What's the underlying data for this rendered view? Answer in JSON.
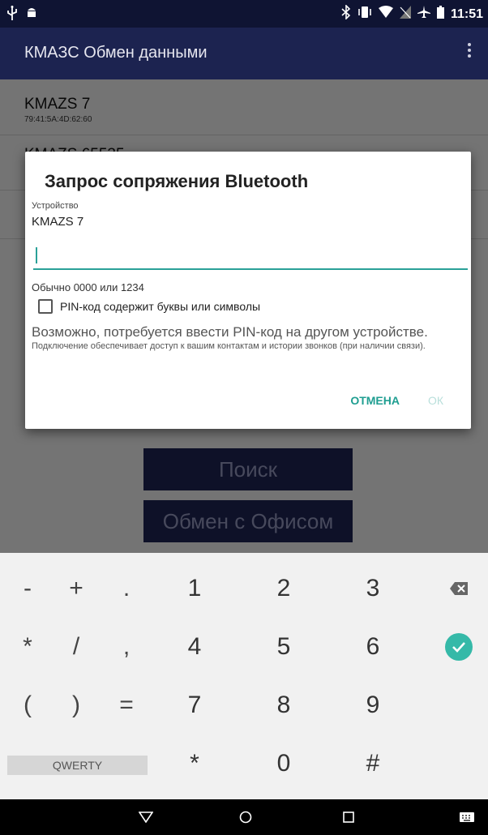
{
  "status_bar": {
    "time": "11:51",
    "left_icons": [
      "usb-icon",
      "android-debug-icon"
    ],
    "right_icons": [
      "bluetooth-icon",
      "vibrate-icon",
      "wifi-icon",
      "signal-off-icon",
      "airplane-icon",
      "battery-icon"
    ]
  },
  "app_bar": {
    "title": "КМАЗС Обмен данными",
    "menu_icon": "overflow-menu-icon"
  },
  "devices": [
    {
      "name": "KMAZS 7",
      "mac": "79:41:5A:4D:62:60"
    },
    {
      "name": "KMAZS 65535",
      "mac": ""
    }
  ],
  "buttons": {
    "search": "Поиск",
    "exchange": "Обмен с Офисом"
  },
  "dialog": {
    "title": "Запрос сопряжения Bluetooth",
    "device_label": "Устройство",
    "device_name": "KMAZS 7",
    "pin_value": "",
    "hint": "Обычно 0000 или 1234",
    "checkbox_label": "PIN-код содержит буквы или символы",
    "checkbox_checked": false,
    "warning": "Возможно, потребуется ввести PIN-код на другом устройстве.",
    "note": "Подключение обеспечивает доступ к вашим контактам и истории звонков (при наличии связи).",
    "cancel": "ОТМЕНА",
    "ok": "ОК",
    "accent_color": "#1f9e91"
  },
  "keyboard": {
    "row1": [
      "-",
      "+",
      ".",
      "1",
      "2",
      "3"
    ],
    "row2": [
      "*",
      "/",
      ",",
      "4",
      "5",
      "6"
    ],
    "row3": [
      "(",
      ")",
      "=",
      "7",
      "8",
      "9"
    ],
    "row4": [
      "*",
      "0",
      "#"
    ],
    "qwerty": "QWERTY",
    "backspace_icon": "backspace-icon",
    "enter_icon": "check-circle-icon"
  },
  "nav_bar": [
    "back-icon",
    "home-icon",
    "recents-icon",
    "keyboard-icon"
  ]
}
